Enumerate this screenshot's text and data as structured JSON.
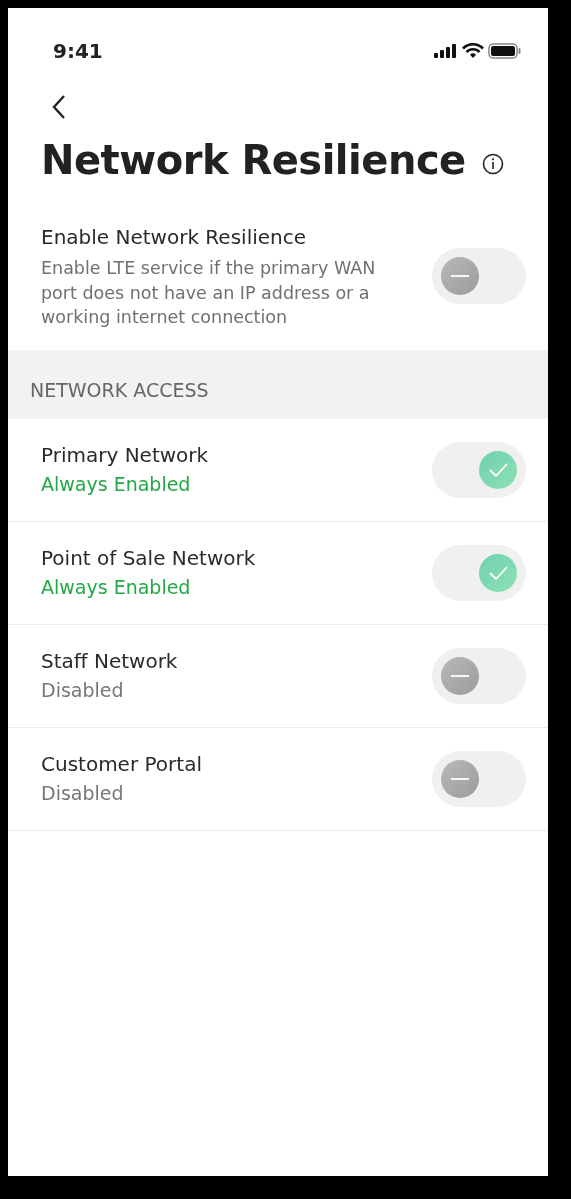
{
  "status_bar": {
    "time": "9:41"
  },
  "header": {
    "title": "Network Resilience"
  },
  "main_setting": {
    "label": "Enable Network Resilience",
    "description": "Enable LTE service if the primary WAN port does not have an IP address or a working internet connection",
    "on": false
  },
  "section": {
    "title": "NETWORK ACCESS"
  },
  "networks": [
    {
      "label": "Primary Network",
      "status": "Always Enabled",
      "on": true
    },
    {
      "label": "Point of Sale Network",
      "status": "Always Enabled",
      "on": true
    },
    {
      "label": "Staff Network",
      "status": "Disabled",
      "on": false
    },
    {
      "label": "Customer Portal",
      "status": "Disabled",
      "on": false
    }
  ]
}
